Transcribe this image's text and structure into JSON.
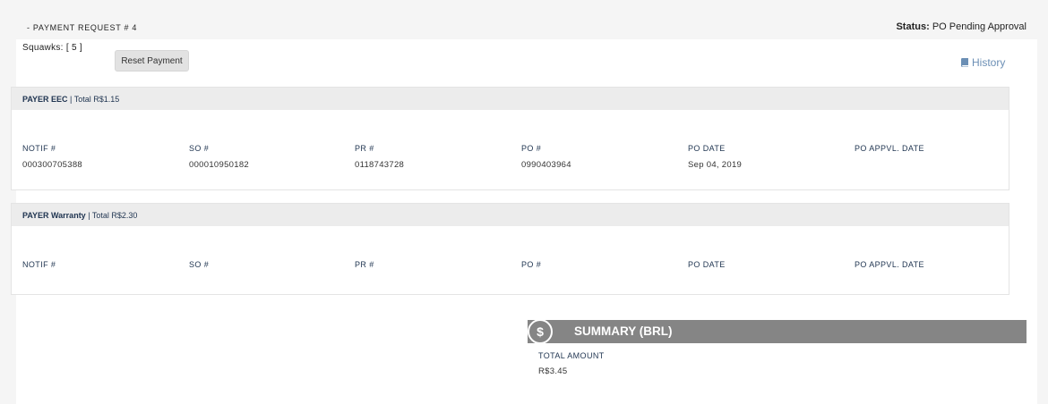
{
  "request": {
    "title": "- PAYMENT REQUEST # 4",
    "status_label": "Status:",
    "status_value": "PO Pending Approval"
  },
  "toolbar": {
    "squawks": "Squawks: [ 5 ]",
    "reset_label": "Reset Payment",
    "history_label": "History"
  },
  "payers": [
    {
      "name": "PAYER EEC",
      "total": "| Total R$1.15",
      "columns": [
        {
          "label": "NOTIF #",
          "value": "000300705388"
        },
        {
          "label": "SO #",
          "value": "000010950182"
        },
        {
          "label": "PR #",
          "value": "0118743728"
        },
        {
          "label": "PO #",
          "value": "0990403964"
        },
        {
          "label": "PO DATE",
          "value": "Sep 04, 2019"
        },
        {
          "label": "PO APPVL. DATE",
          "value": ""
        }
      ]
    },
    {
      "name": "PAYER Warranty",
      "total": "| Total R$2.30",
      "columns": [
        {
          "label": "NOTIF #",
          "value": ""
        },
        {
          "label": "SO #",
          "value": ""
        },
        {
          "label": "PR #",
          "value": ""
        },
        {
          "label": "PO #",
          "value": ""
        },
        {
          "label": "PO DATE",
          "value": ""
        },
        {
          "label": "PO APPVL. DATE",
          "value": ""
        }
      ]
    }
  ],
  "summary": {
    "icon": "$",
    "title": "SUMMARY (BRL)",
    "total_label": "TOTAL AMOUNT",
    "total_value": "R$3.45"
  },
  "colors": {
    "header_bg": "#f5f5f5",
    "payer_head_bg": "#ececec",
    "summary_bar": "#858585",
    "link": "#6b8fb5",
    "label_navy": "#1f3450"
  }
}
